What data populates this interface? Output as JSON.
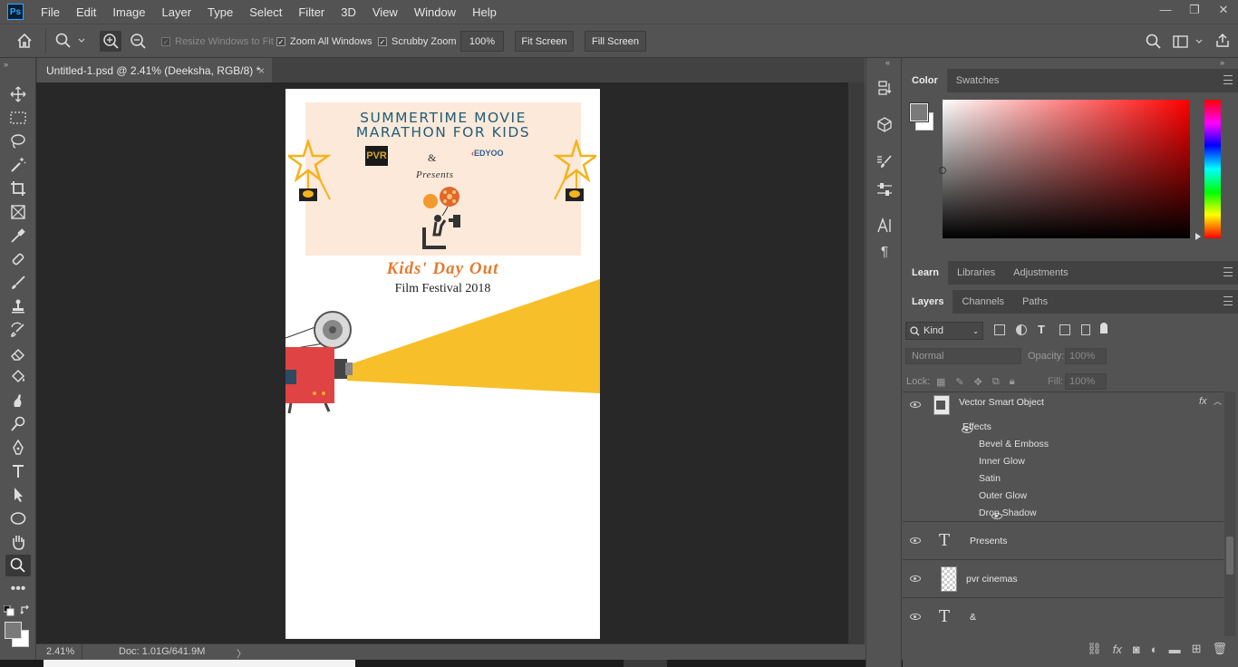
{
  "app": {
    "logo": "Ps",
    "menu": [
      "File",
      "Edit",
      "Image",
      "Layer",
      "Type",
      "Select",
      "Filter",
      "3D",
      "View",
      "Window",
      "Help"
    ],
    "window_controls": [
      "—",
      "❐",
      "✕"
    ]
  },
  "options_bar": {
    "resize_windows_label": "Resize Windows to Fit",
    "resize_windows_checked": true,
    "zoom_all_windows_label": "Zoom All Windows",
    "zoom_all_windows_checked": true,
    "scrubby_zoom_label": "Scrubby Zoom",
    "scrubby_zoom_checked": true,
    "zoom_value": "100%",
    "fit_screen_label": "Fit Screen",
    "fill_screen_label": "Fill Screen"
  },
  "document": {
    "tab_title": "Untitled-1.psd @ 2.41% (Deeksha, RGB/8) *",
    "close_glyph": "×",
    "zoom_status": "2.41%",
    "doc_status": "Doc: 1.01G/641.9M",
    "status_arrow": "〉",
    "poster": {
      "headline_1": "SUMMERTIME MOVIE",
      "headline_2": "MARATHON FOR KIDS",
      "pvr_logo": "PVR",
      "ampersand": "&",
      "edyoo_logo": "EDYOO",
      "presents": "Presents",
      "event_title": "Kids' Day Out",
      "festival": "Film Festival 2018"
    }
  },
  "color_panel": {
    "tabs": [
      "Color",
      "Swatches"
    ],
    "active_tab": "Color",
    "foreground": "#7a7a7a",
    "background": "#ffffff",
    "hue": "#ff0000"
  },
  "learn_panel": {
    "tabs": [
      "Learn",
      "Libraries",
      "Adjustments"
    ],
    "active_tab": "Learn"
  },
  "layers_panel": {
    "tabs": [
      "Layers",
      "Channels",
      "Paths"
    ],
    "active_tab": "Layers",
    "filter_kind": "Kind",
    "blend_mode": "Normal",
    "opacity_label": "Opacity:",
    "opacity_value": "100%",
    "lock_label": "Lock:",
    "fill_label": "Fill:",
    "fill_value": "100%",
    "smart_object_name": "Vector Smart Object",
    "fx_glyph": "fx",
    "effects_label": "Effects",
    "effects": [
      "Bevel & Emboss",
      "Inner Glow",
      "Satin",
      "Outer Glow",
      "Drop Shadow"
    ],
    "layers": [
      {
        "name": "Presents",
        "kind": "type"
      },
      {
        "name": "pvr cinemas",
        "kind": "image"
      },
      {
        "name": "&",
        "kind": "type"
      }
    ]
  }
}
